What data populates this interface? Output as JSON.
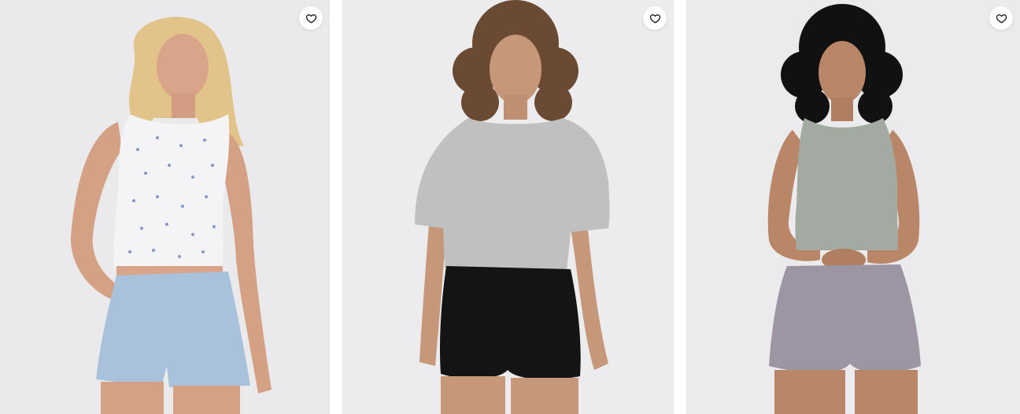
{
  "products": [
    {
      "image_alt": "",
      "top_color": "#f4f4f7",
      "top_print_color": "#8a96c8",
      "bottom_color": "#a9c2dc",
      "hair_color": "#e2c48a",
      "background_color": "#eaeaec",
      "favorite_icon": "heart-outline-icon"
    },
    {
      "image_alt": "",
      "top_color": "#bfc0bf",
      "bottom_color": "#141414",
      "hair_color": "#6b4a33",
      "background_color": "#ececee",
      "favorite_icon": "heart-outline-icon"
    },
    {
      "image_alt": "",
      "top_color": "#a3aaa2",
      "bottom_color": "#9c96a4",
      "hair_color": "#111111",
      "background_color": "#ebebed",
      "favorite_icon": "heart-outline-icon"
    }
  ]
}
